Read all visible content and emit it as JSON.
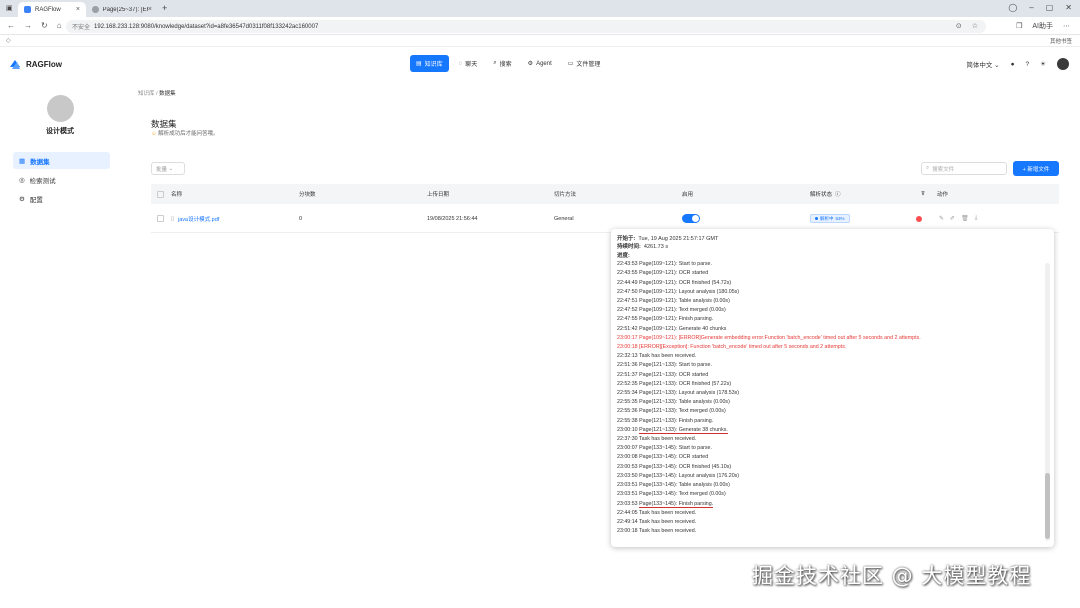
{
  "browser": {
    "tabs": [
      {
        "title": "RAGFlow",
        "active": true
      },
      {
        "title": "Page(25~37): [ERROR]...",
        "active": false
      }
    ],
    "url": "192.168.233.128:9080/knowledge/dataset?id=a8fe36547d0311f08f133242ac160007",
    "insecure_label": "不安全",
    "right_label": "AI助手",
    "bookmarks_right": "其他书签"
  },
  "app": {
    "logo": "RAGFlow",
    "nav": [
      {
        "label": "知识库",
        "icon": "book-icon",
        "active": true
      },
      {
        "label": "聊天",
        "icon": "chat-icon",
        "active": false
      },
      {
        "label": "搜索",
        "icon": "search-icon",
        "active": false
      },
      {
        "label": "Agent",
        "icon": "agent-icon",
        "active": false
      },
      {
        "label": "文件管理",
        "icon": "folder-icon",
        "active": false
      }
    ],
    "language": "简体中文"
  },
  "sidebar": {
    "title": "设计模式",
    "items": [
      {
        "label": "数据集",
        "icon": "dataset-icon",
        "active": true
      },
      {
        "label": "检索测试",
        "icon": "retrieval-icon",
        "active": false
      },
      {
        "label": "配置",
        "icon": "settings-icon",
        "active": false
      }
    ]
  },
  "main": {
    "breadcrumb": [
      "知识库",
      "数据集"
    ],
    "title": "数据集",
    "subtitle": "解析成功后才能问答哦。",
    "filter_label": "批量",
    "search_placeholder": "搜索文件",
    "add_button": "+ 新增文件",
    "table": {
      "headers": [
        "名称",
        "分块数",
        "上传日期",
        "切片方法",
        "启用",
        "解析状态",
        "动作"
      ],
      "rows": [
        {
          "name": "java设计模式.pdf",
          "chunks": "0",
          "upload_date": "19/08/2025 21:56:44",
          "method": "General",
          "enabled": true,
          "status": "解析中",
          "progress": "53%"
        }
      ]
    }
  },
  "popover": {
    "start_label": "开始于:",
    "start_value": "Tue, 19 Aug 2025 21:57:17 GMT",
    "duration_label": "持续时间:",
    "duration_value": "4261.73 s",
    "progress_label": "进度:",
    "lines": [
      {
        "text": "22:43:53 Page(109~121): Start to parse.",
        "error": false
      },
      {
        "text": "22:43:55 Page(109~121): OCR started",
        "error": false
      },
      {
        "text": "22:44:49 Page(109~121): OCR finished (54.72s)",
        "error": false
      },
      {
        "text": "22:47:50 Page(109~121): Layout analysis (180.05s)",
        "error": false
      },
      {
        "text": "22:47:51 Page(109~121): Table analysis (0.00s)",
        "error": false
      },
      {
        "text": "22:47:52 Page(109~121): Text merged (0.00s)",
        "error": false
      },
      {
        "text": "22:47:55 Page(109~121): Finish parsing.",
        "error": false
      },
      {
        "text": "22:51:42 Page(109~121): Generate 40 chunks",
        "error": false
      },
      {
        "text": "23:00:17 Page(109~121): [ERROR]Generate embedding error:Function 'batch_encode' timed out after 5 seconds and 2 attempts.",
        "error": true
      },
      {
        "text": "23:00:18 [ERROR][Exception]: Function 'batch_encode' timed out after 5 seconds and 2 attempts.",
        "error": true
      },
      {
        "text": "22:32:13 Task has been received.",
        "error": false
      },
      {
        "text": "22:51:36 Page(121~133): Start to parse.",
        "error": false
      },
      {
        "text": "22:51:37 Page(121~133): OCR started",
        "error": false
      },
      {
        "text": "22:52:35 Page(121~133): OCR finished (57.22s)",
        "error": false
      },
      {
        "text": "22:55:34 Page(121~133): Layout analysis (178.53s)",
        "error": false
      },
      {
        "text": "22:55:35 Page(121~133): Table analysis (0.00s)",
        "error": false
      },
      {
        "text": "22:55:36 Page(121~133): Text merged (0.00s)",
        "error": false
      },
      {
        "text": "22:55:38 Page(121~133): Finish parsing.",
        "error": false
      },
      {
        "prefix": "23:00:10 ",
        "highlight": "Page(121~133): Generate 38 chunks.",
        "error": false
      },
      {
        "text": "22:37:30 Task has been received.",
        "error": false
      },
      {
        "text": "23:00:07 Page(133~145): Start to parse.",
        "error": false
      },
      {
        "text": "23:00:08 Page(133~145): OCR started",
        "error": false
      },
      {
        "text": "23:00:53 Page(133~145): OCR finished (45.10s)",
        "error": false
      },
      {
        "text": "23:03:50 Page(133~145): Layout analysis (176.20s)",
        "error": false
      },
      {
        "text": "23:03:51 Page(133~145): Table analysis (0.00s)",
        "error": false
      },
      {
        "text": "23:03:51 Page(133~145): Text merged (0.00s)",
        "error": false
      },
      {
        "prefix": "23:03:53 ",
        "highlight": "Page(133~145): Finish parsing.",
        "error": false
      },
      {
        "text": "22:44:05 Task has been received.",
        "error": false
      },
      {
        "text": "22:49:14 Task has been received.",
        "error": false
      },
      {
        "text": "23:00:18 Task has been received.",
        "error": false
      }
    ]
  },
  "watermark": "掘金技术社区 @ 大模型教程",
  "colors": {
    "accent": "#1677ff",
    "error": "#e53935",
    "highlight_underline": "#d32f2f"
  }
}
